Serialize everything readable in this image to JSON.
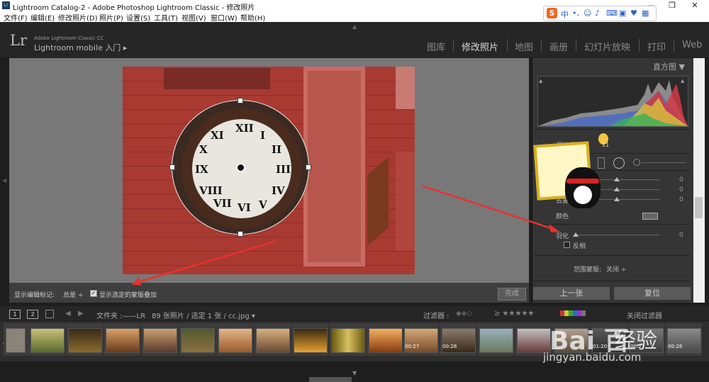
{
  "window": {
    "title": "Lightroom Catalog-2 - Adobe Photoshop Lightroom Classic - 修改照片",
    "app_icon": "Lr",
    "controls": [
      "minimize-icon",
      "restore-icon",
      "close-icon"
    ]
  },
  "menu": [
    "文件(F)",
    "编辑(E)",
    "修改照片(D)",
    "照片(P)",
    "设置(S)",
    "工具(T)",
    "视图(V)",
    "窗口(W)",
    "帮助(H)"
  ],
  "ime_toolbar": {
    "logo": "S",
    "mode": "中",
    "icons": [
      "punctuation-icon",
      "emoji-icon",
      "mic-icon",
      "keyboard-icon",
      "toolbox-icon",
      "shirt-icon",
      "user-icon",
      "grid-icon"
    ]
  },
  "identity": {
    "logo": "Lr",
    "line1": "Adobe Lightroom Classic CC",
    "line2": "Lightroom mobile 入门 ▸"
  },
  "modules": [
    "图库",
    "修改照片",
    "地图",
    "画册",
    "幻灯片放映",
    "打印",
    "Web"
  ],
  "active_module": "修改照片",
  "toolbar": {
    "show_edit_pins_label": "显示编辑标记:",
    "show_edit_pins_value": "总是 ÷",
    "overlay_checkbox": "✓",
    "overlay_label": "显示选定的蒙版叠加",
    "done_label": "完成"
  },
  "right_panel": {
    "histogram_title": "直方图 ▼",
    "original_photo_label": "原始照片",
    "mask_labels": [
      {
        "label": "去",
        "value": "0"
      },
      {
        "label": "去雾",
        "value": "0"
      }
    ],
    "top_values": [
      "0",
      "0"
    ],
    "color_label": "颜色",
    "feather_label": "羽化",
    "feather_value": "0",
    "invert_label": "反相",
    "range_mask_label": "范围蒙版:",
    "range_mask_value": "关闭 ÷",
    "prev_button": "上一张",
    "reset_button": "复位",
    "badge_count": "11"
  },
  "filmstrip_header": {
    "page1": "1",
    "page2": "2",
    "path_label": "文件夹 :——LR",
    "count_label": "89 张照片 / 选定 1 张 / cc.jpg ▾",
    "filter_label": "过滤器 :",
    "rating": "≥ ★★★★★",
    "filter_off": "关闭过滤器"
  },
  "filmstrip_durations": [
    "00:27",
    "00:28",
    "01:20",
    "00:27",
    "00:28"
  ],
  "watermark": {
    "logo": "Bai  百",
    "site_text": "经验",
    "url": "jingyan.baidu.com"
  },
  "colors": {
    "accent_arrow": "#e8322f",
    "photo_mask": "#a83a32",
    "panel_bg": "#353535"
  }
}
